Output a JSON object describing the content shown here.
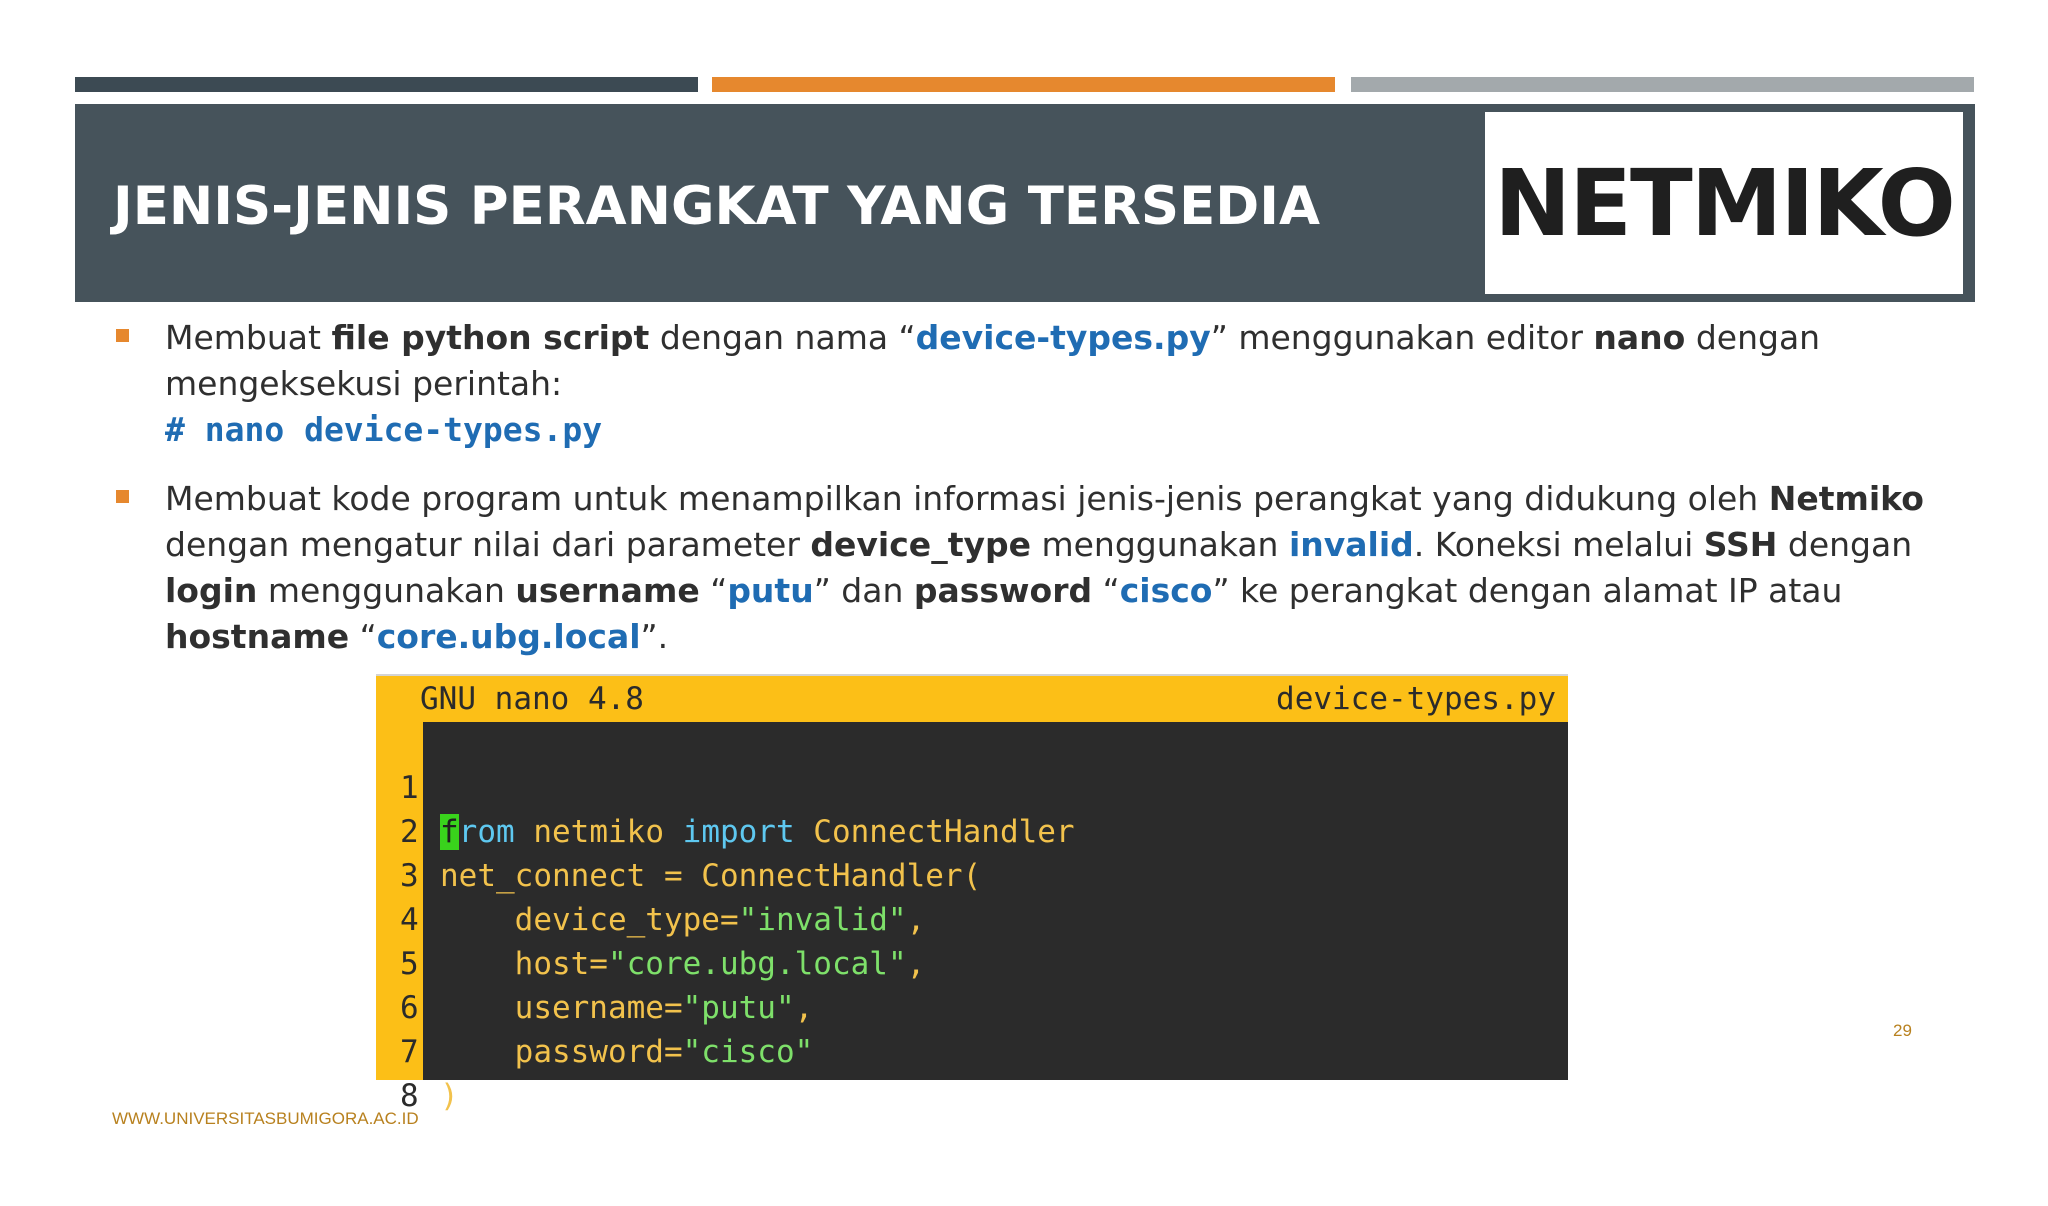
{
  "slide": {
    "title": "JENIS-JENIS PERANGKAT YANG TERSEDIA",
    "logo_text": "NETMIKO",
    "page_number": "29",
    "footer": "WWW.UNIVERSITASBUMIGORA.AC.ID"
  },
  "colors": {
    "accent_orange": "#e6882e",
    "banner": "#46535b",
    "highlight_blue": "#1f6cb3",
    "nano_yellow": "#fcbf17"
  },
  "bullet1": {
    "t1": "Membuat ",
    "b1": "file python script",
    "t2": " dengan nama “",
    "h1": "device-types.py",
    "t3": "” menggunakan editor ",
    "b2": "nano",
    "t4": " dengan mengeksekusi perintah:",
    "command": "# nano device-types.py"
  },
  "bullet2": {
    "t1": "Membuat kode program untuk menampilkan informasi jenis-jenis perangkat yang didukung oleh ",
    "b1": "Netmiko",
    "t2": " dengan mengatur nilai dari parameter ",
    "b2": "device_type",
    "t3": " menggunakan ",
    "h1": "invalid",
    "t4": ". Koneksi melalui ",
    "b3": "SSH",
    "t5": " dengan ",
    "b4": "login",
    "t6": " menggunakan ",
    "b5": "username",
    "t7": " “",
    "h2": "putu",
    "t8": "” dan ",
    "b6": "password",
    "t9": " “",
    "h3": "cisco",
    "t10": "” ke perangkat dengan alamat IP atau ",
    "b7": "hostname",
    "t11": " “",
    "h4": "core.ubg.local",
    "t12": "”."
  },
  "editor": {
    "version": "GNU nano 4.8",
    "filename": "device-types.py",
    "lines": [
      {
        "n": "1",
        "cursor": "f",
        "kw1": "rom",
        "mid": " netmiko ",
        "kw2": "import",
        "rest": " ConnectHandler"
      },
      {
        "n": "2",
        "text": "net_connect = ConnectHandler("
      },
      {
        "n": "3",
        "key": "    device_type=",
        "val": "\"invalid\"",
        "tail": ","
      },
      {
        "n": "4",
        "key": "    host=",
        "val": "\"core.ubg.local\"",
        "tail": ","
      },
      {
        "n": "5",
        "key": "    username=",
        "val": "\"putu\"",
        "tail": ","
      },
      {
        "n": "6",
        "key": "    password=",
        "val": "\"cisco\"",
        "tail": ""
      },
      {
        "n": "7",
        "text": ")"
      },
      {
        "n": "8",
        "text": ""
      }
    ]
  }
}
